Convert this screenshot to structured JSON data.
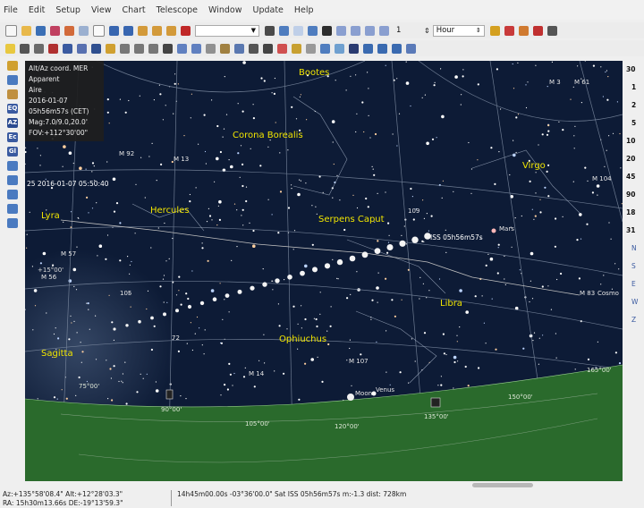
{
  "menu": [
    "File",
    "Edit",
    "Setup",
    "View",
    "Chart",
    "Telescope",
    "Window",
    "Update",
    "Help"
  ],
  "toolbar": {
    "step_value": "1",
    "step_unit": "Hour"
  },
  "left_toolbar": [
    "Alt",
    "EQ",
    "AZ",
    "Ec",
    "Gl"
  ],
  "info": {
    "lines": [
      "Alt/Az coord. MER",
      "Apparent",
      "Aire",
      "2016-01-07",
      "05h56m57s (CET)",
      "Mag:7.0/9.0,20.0'",
      "FOV:+112°30'00\""
    ]
  },
  "chart": {
    "track_label": "25 2016-01-07 05:50:40",
    "constellations": [
      "Bootes",
      "Corona Borealis",
      "Virgo",
      "Hercules",
      "Serpens Caput",
      "Lyra",
      "Libra",
      "Ophiuchus",
      "Sagitta"
    ],
    "objects": [
      "M 92",
      "M 13",
      "M 104",
      "109",
      "Mars",
      "M 83",
      "Cosmo",
      "M 57",
      "M 56",
      "105",
      "72",
      "M 14",
      "M 107",
      "Moon",
      "Venus",
      "M 61",
      "M 3"
    ],
    "iss_label": "ISS 05h56m57s",
    "horizon_labels": [
      "75°00'",
      "90°00'",
      "105°00'",
      "120°00'",
      "135°00'",
      "150°00'",
      "165°00'"
    ],
    "alt_labels": [
      "+15°00'"
    ]
  },
  "right_panel": [
    "30",
    "1",
    "2",
    "5",
    "10",
    "20",
    "45",
    "90",
    "18",
    "31",
    "N",
    "S",
    "E",
    "W",
    "Z"
  ],
  "status": {
    "line1": "Az:+135°58'08.4\" Alt:+12°28'03.3\"",
    "line2": "RA: 15h30m13.66s DE:-19°13'59.3\"",
    "object": "14h45m00.00s -03°36'00.0\" Sat ISS 05h56m57s m:-1.3 dist: 728km"
  },
  "colors": {
    "sky": "#0d1b36",
    "ground": "#2a6a2c",
    "constellation_label": "#f2e600",
    "track": "#f4f4f4",
    "grid": "#7c8aa0"
  }
}
